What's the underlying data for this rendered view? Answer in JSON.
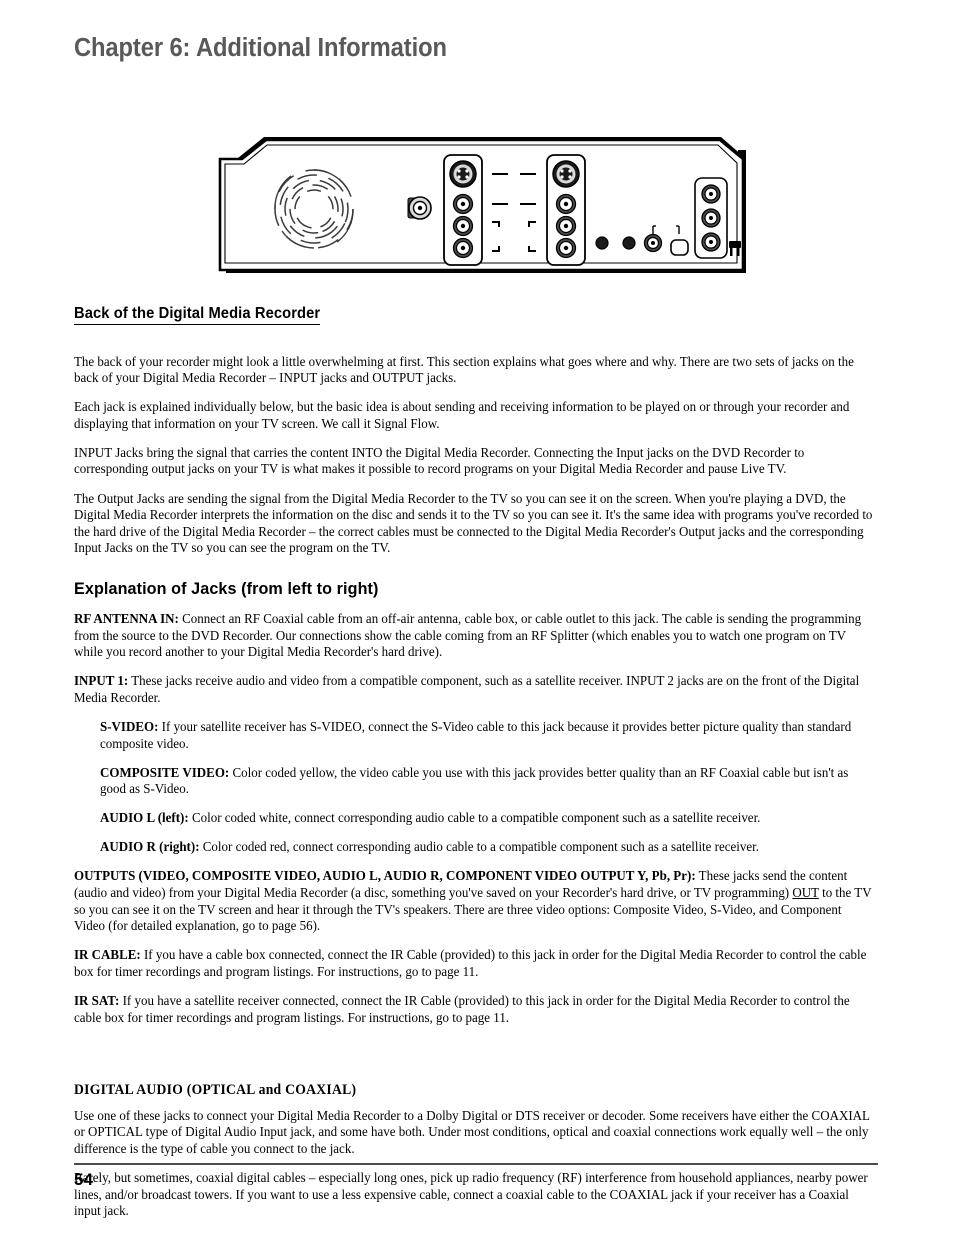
{
  "document": {
    "chapter_title": "Chapter 6: Additional Information",
    "page_number": "54"
  },
  "figure": {
    "name": "back-panel-illustration",
    "caption": "",
    "parts": [
      "cooling-fan-vent",
      "rf-antenna-in-jack",
      "input-jack-block-left",
      "input-jack-block-right",
      "ir-cable-jack",
      "ir-sat-jack",
      "digital-audio-coaxial-jack",
      "digital-audio-optical-jack",
      "output-jack-block",
      "power-cord-icon"
    ]
  },
  "sections": {
    "back_of_recorder": {
      "heading": "Back of the Digital Media Recorder",
      "paragraphs": [
        "The back of your recorder might look a little overwhelming at first. This section explains what goes where and why. There are two sets of jacks on the back of your Digital Media Recorder – INPUT jacks and OUTPUT jacks.",
        "Each jack is explained individually below, but the basic idea is about sending and receiving information to be played on or through your recorder and displaying that information on your TV screen. We call it Signal Flow.",
        "INPUT Jacks bring the signal that carries the content INTO the Digital Media Recorder. Connecting the Input jacks on the DVD Recorder to corresponding output jacks on your TV is what makes it possible to record programs on your Digital Media Recorder and pause Live TV.",
        "The Output Jacks are sending the signal from the Digital Media Recorder to the TV so you can see it on the screen. When you're playing a DVD, the Digital Media Recorder interprets the information on the disc and sends it to the TV so you can see it. It's the same idea with programs you've recorded to the hard drive of the Digital Media Recorder – the correct cables must be connected to the Digital Media Recorder's Output jacks and the corresponding Input Jacks on the TV so you can see the program on the TV."
      ]
    },
    "explanation_of_jacks": {
      "heading": "Explanation of Jacks (from left to right)",
      "entries": [
        {
          "label": "RF ANTENNA IN:",
          "text": " Connect an RF Coaxial cable from an off-air antenna, cable box, or cable outlet to this jack. The cable is sending the programming from the source to the DVD Recorder. Our connections show the cable coming from an RF Splitter (which enables you to watch one program on TV while you record another to your Digital Media Recorder's hard drive)."
        },
        {
          "label": "INPUT 1:",
          "text": " These jacks receive audio and video from a compatible component, such as a satellite receiver. INPUT 2 jacks are on the front of the Digital Media Recorder."
        },
        {
          "label": "S-VIDEO:",
          "text": " If your satellite receiver has S-VIDEO, connect the S-Video cable to this jack because it provides better picture quality than standard composite video.",
          "indented": true
        },
        {
          "label": "COMPOSITE VIDEO:",
          "text": " Color coded yellow, the video cable you use with this jack provides better quality than an RF Coaxial cable but isn't as good as S-Video.",
          "indented": true
        },
        {
          "label": "AUDIO L (left):",
          "text": " Color coded white, connect corresponding audio cable to a compatible component such as a satellite receiver.",
          "indented": true
        },
        {
          "label": "AUDIO R (right):",
          "text": " Color coded red, connect corresponding audio cable to a compatible component such as a satellite receiver.",
          "indented": true
        }
      ],
      "outputs": {
        "label": "OUTPUTS (VIDEO, COMPOSITE VIDEO, AUDIO L, AUDIO R, COMPONENT VIDEO OUTPUT Y, Pb, Pr):",
        "text_before": " These jacks send the content (audio and video) from your Digital Media Recorder (a disc, something you've saved on your Recorder's hard drive, or TV programming) ",
        "emphasis": "OUT",
        "text_after": " to the TV so you can see it on the TV screen and hear it through the TV's speakers. There are three video options: Composite Video, S-Video, and Component Video (for detailed explanation, go to page 56)."
      },
      "ir_entries": [
        {
          "label": "IR CABLE:",
          "text": " If you have a cable box connected, connect the IR Cable (provided) to this jack in order for the Digital Media Recorder to control the cable box for timer recordings and program listings. For instructions, go to page 11."
        },
        {
          "label": "IR SAT:",
          "text": " If you have a satellite receiver connected, connect the IR Cable (provided) to this jack in order for the Digital Media Recorder to control the cable box for timer recordings and program listings. For instructions, go to page 11."
        }
      ]
    },
    "digital_audio": {
      "heading": "DIGITAL AUDIO (OPTICAL and COAXIAL)",
      "paragraphs": [
        "Use one of these jacks to connect your Digital Media Recorder to a Dolby Digital or DTS receiver or decoder. Some receivers have either the COAXIAL or OPTICAL type of Digital Audio Input jack, and some have both. Under most conditions, optical and coaxial connections work equally well – the only difference is the type of cable you connect to the jack.",
        "Rarely, but sometimes, coaxial digital cables – especially long ones, pick up radio frequency (RF) interference from household appliances, nearby power lines, and/or broadcast towers. If you want to use a less expensive cable, connect a coaxial cable to the COAXIAL jack if your receiver has a Coaxial input jack."
      ]
    }
  },
  "colors": {
    "chapter_title": "#58595b",
    "body_text": "#000000",
    "footer_rule": "#4d4d4f"
  }
}
